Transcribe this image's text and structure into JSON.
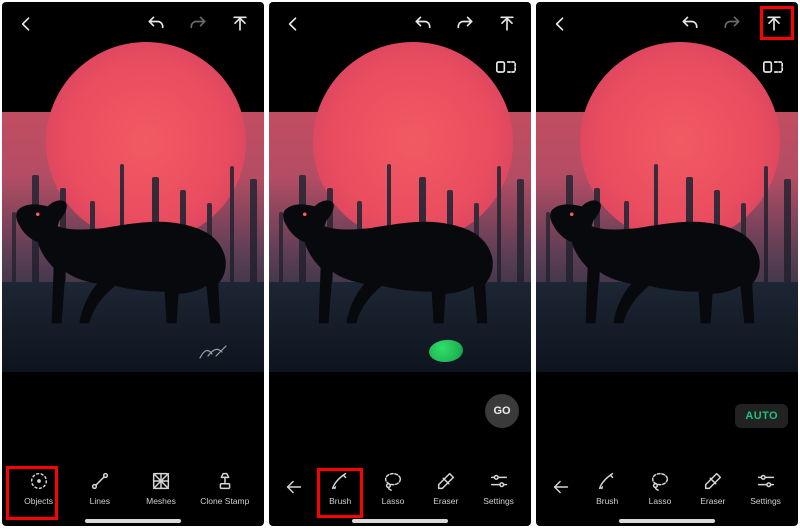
{
  "screens": [
    {
      "toolbar": [
        {
          "id": "objects",
          "label": "Objects"
        },
        {
          "id": "lines",
          "label": "Lines"
        },
        {
          "id": "meshes",
          "label": "Meshes"
        },
        {
          "id": "clonestamp",
          "label": "Clone Stamp"
        }
      ],
      "highlight_tool_index": 0,
      "show_compare": false,
      "show_signature": true,
      "show_blob": false,
      "action_btn": null,
      "highlight_export": false,
      "redo_dim": true,
      "tool_back": false
    },
    {
      "toolbar": [
        {
          "id": "brush",
          "label": "Brush"
        },
        {
          "id": "lasso",
          "label": "Lasso"
        },
        {
          "id": "eraser",
          "label": "Eraser"
        },
        {
          "id": "settings",
          "label": "Settings"
        }
      ],
      "highlight_tool_index": 0,
      "show_compare": true,
      "show_signature": false,
      "show_blob": true,
      "action_btn": {
        "type": "go",
        "label": "GO"
      },
      "highlight_export": false,
      "redo_dim": false,
      "tool_back": true
    },
    {
      "toolbar": [
        {
          "id": "brush",
          "label": "Brush"
        },
        {
          "id": "lasso",
          "label": "Lasso"
        },
        {
          "id": "eraser",
          "label": "Eraser"
        },
        {
          "id": "settings",
          "label": "Settings"
        }
      ],
      "highlight_tool_index": -1,
      "show_compare": true,
      "show_signature": false,
      "show_blob": false,
      "action_btn": {
        "type": "auto",
        "label": "AUTO"
      },
      "highlight_export": true,
      "redo_dim": true,
      "tool_back": true
    }
  ],
  "icons": {
    "objects": "objects-icon",
    "lines": "lines-icon",
    "meshes": "meshes-icon",
    "clonestamp": "clonestamp-icon",
    "brush": "brush-icon",
    "lasso": "lasso-icon",
    "eraser": "eraser-icon",
    "settings": "settings-icon"
  }
}
